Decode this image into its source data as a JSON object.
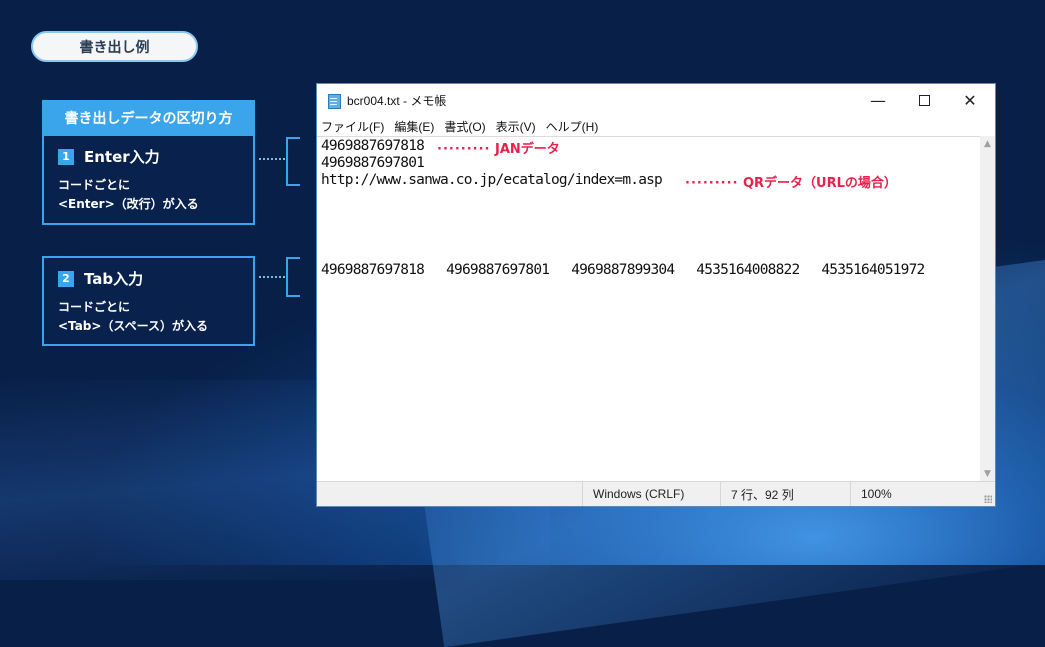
{
  "example_label": "書き出し例",
  "panel": {
    "header": "書き出しデータの区切り方",
    "boxes": [
      {
        "number": "1",
        "title": "Enter入力",
        "line1": "コードごとに",
        "line2": "<Enter>（改行）が入る"
      },
      {
        "number": "2",
        "title": "Tab入力",
        "line1": "コードごとに",
        "line2": "<Tab>（スペース）が入る"
      }
    ]
  },
  "window": {
    "title": "bcr004.txt - メモ帳",
    "menu": [
      "ファイル(F)",
      "編集(E)",
      "書式(O)",
      "表示(V)",
      "ヘルプ(H)"
    ],
    "lines": [
      "4969887697818",
      "4969887697801",
      "http://www.sanwa.co.jp/ecatalog/index=m.asp"
    ],
    "tab_line": [
      "4969887697818",
      "4969887697801",
      "4969887899304",
      "4535164008822",
      "4535164051972"
    ],
    "annotations": {
      "jan": "JANデータ",
      "qr": "QRデータ（URLの場合）"
    },
    "status": {
      "encoding": "Windows (CRLF)",
      "position": "7 行、92 列",
      "zoom": "100%"
    }
  },
  "colors": {
    "accent": "#3ba5ec",
    "annotation": "#e8204a"
  },
  "icons": [
    "notepad-icon",
    "minimize-icon",
    "maximize-icon",
    "close-icon",
    "scroll-up-icon",
    "scroll-down-icon",
    "resize-grip-icon"
  ]
}
